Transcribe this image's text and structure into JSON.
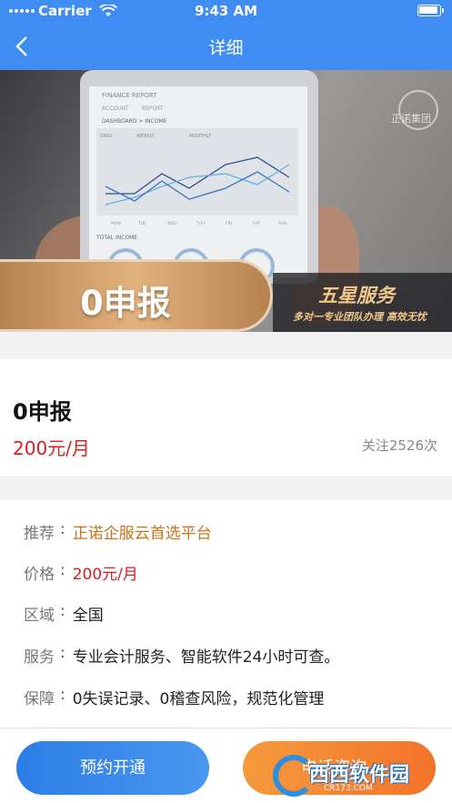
{
  "status_bar": {
    "carrier": "Carrier",
    "time": "9:43 AM"
  },
  "nav": {
    "title": "详细",
    "back_icon": "chevron-left-icon"
  },
  "banner": {
    "tablet_title": "FINANCE REPORT",
    "tablet_tabs": [
      "ACCOUNT",
      "REPORT"
    ],
    "tablet_breadcrumb": "DASHBOARD > INCOME",
    "tablet_periods": [
      "DAILY",
      "WEEKLY",
      "MONTHLY"
    ],
    "tablet_days": [
      "MON",
      "TUE",
      "WED",
      "THU",
      "FRI",
      "SAT",
      "SUN"
    ],
    "tablet_total": "TOTAL INCOME",
    "watermark": "正诺集团",
    "main_text": "0申报",
    "badge_title": "五星服务",
    "badge_sub": "多对一专业团队办理 高效无忧"
  },
  "product": {
    "name": "0申报",
    "price": "200元/月",
    "follow": "关注2526次"
  },
  "details": [
    {
      "label": "推荐",
      "value": "正诺企服云首选平台",
      "style": "orange"
    },
    {
      "label": "价格",
      "value": "200元/月",
      "style": "red"
    },
    {
      "label": "区域",
      "value": "全国",
      "style": ""
    },
    {
      "label": "服务",
      "value": "专业会计服务、智能软件24小时可查。",
      "style": ""
    },
    {
      "label": "保障",
      "value": "0失误记录、0稽查风险，规范化管理",
      "style": ""
    }
  ],
  "buttons": {
    "book": "预约开通",
    "consult": "电话咨询"
  },
  "site_logo": {
    "text": "西西软件园",
    "sub": "CR173.COM"
  },
  "colors": {
    "brand_blue": "#3f8cf3",
    "price_red": "#d22222",
    "recommend_orange": "#c9731a",
    "consult_orange": "#f4722a"
  }
}
